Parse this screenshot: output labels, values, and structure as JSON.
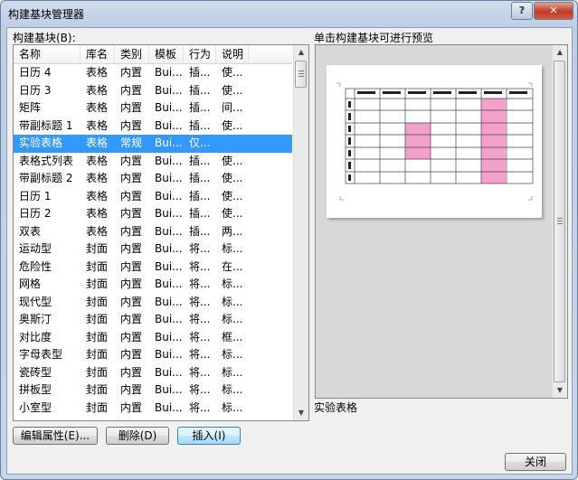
{
  "window": {
    "title": "构建基块管理器",
    "help_label": "?",
    "close_glyph": "✕"
  },
  "list": {
    "label": "构建基块(B):",
    "columns": [
      "名称",
      "库名",
      "类别",
      "模板",
      "行为",
      "说明"
    ],
    "rows": [
      [
        "日历 4",
        "表格",
        "内置",
        "Bui...",
        "插...",
        "使..."
      ],
      [
        "日历 3",
        "表格",
        "内置",
        "Bui...",
        "插...",
        "使..."
      ],
      [
        "矩阵",
        "表格",
        "内置",
        "Bui...",
        "插...",
        "间..."
      ],
      [
        "带副标题 1",
        "表格",
        "内置",
        "Bui...",
        "插...",
        "使..."
      ],
      [
        "实验表格",
        "表格",
        "常规",
        "Bui...",
        "仅...",
        ""
      ],
      [
        "表格式列表",
        "表格",
        "内置",
        "Bui...",
        "插...",
        "使..."
      ],
      [
        "带副标题 2",
        "表格",
        "内置",
        "Bui...",
        "插...",
        "使..."
      ],
      [
        "日历 1",
        "表格",
        "内置",
        "Bui...",
        "插...",
        "使..."
      ],
      [
        "日历 2",
        "表格",
        "内置",
        "Bui...",
        "插...",
        "使..."
      ],
      [
        "双表",
        "表格",
        "内置",
        "Bui...",
        "插...",
        "两..."
      ],
      [
        "运动型",
        "封面",
        "内置",
        "Bui...",
        "将...",
        "标..."
      ],
      [
        "危险性",
        "封面",
        "内置",
        "Bui...",
        "将...",
        "在..."
      ],
      [
        "网格",
        "封面",
        "内置",
        "Bui...",
        "将...",
        "标..."
      ],
      [
        "现代型",
        "封面",
        "内置",
        "Bui...",
        "将...",
        "标..."
      ],
      [
        "奥斯汀",
        "封面",
        "内置",
        "Bui...",
        "将...",
        "标..."
      ],
      [
        "对比度",
        "封面",
        "内置",
        "Bui...",
        "将...",
        "框..."
      ],
      [
        "字母表型",
        "封面",
        "内置",
        "Bui...",
        "将...",
        "标..."
      ],
      [
        "瓷砖型",
        "封面",
        "内置",
        "Bui...",
        "将...",
        "标..."
      ],
      [
        "拼板型",
        "封面",
        "内置",
        "Bui...",
        "将...",
        "标..."
      ],
      [
        "小室型",
        "封面",
        "内置",
        "Bui...",
        "将...",
        "标..."
      ]
    ],
    "selected_index": 4
  },
  "buttons": {
    "edit": "编辑属性(E)...",
    "delete": "删除(D)",
    "insert": "插入(I)",
    "close": "关闭"
  },
  "preview": {
    "label": "单击构建基块可进行预览",
    "caption": "实验表格"
  },
  "colors": {
    "selection": "#3399ff",
    "preview_highlight": "#f4a0cc"
  }
}
